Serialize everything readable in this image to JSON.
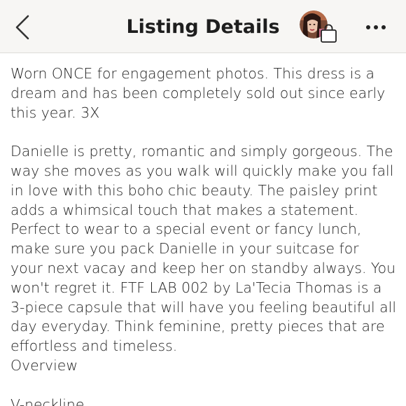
{
  "header": {
    "title": "Listing Details"
  },
  "listing": {
    "intro_lines": [
      "Worn ONCE for engagement photos. This dress is a",
      "dream and has been completely sold out since early",
      "this year. 3X"
    ],
    "description_lines": [
      "Danielle is pretty, romantic and simply gorgeous. The",
      "way she moves as you walk will quickly make you fall",
      "in love with this boho chic beauty. The paisley print",
      "adds a whimsical touch that makes a statement.",
      "Perfect to wear to a special event or fancy lunch,",
      "make sure you pack Danielle in your suitcase for",
      "your next vacay and keep her on standby always. You",
      "won't regret it. FTF LAB 002 by La'Tecia Thomas is a",
      "3-piece capsule that will have you feeling beautiful all",
      "day everyday. Think feminine, pretty pieces that are",
      "effortless and timeless."
    ],
    "overview_label": "Overview",
    "next_line": "V-neckline"
  },
  "icons": {
    "back": "chevron-left-icon",
    "avatar": "user-avatar",
    "bag": "shopping-bag-icon",
    "more": "more-horizontal-icon"
  }
}
